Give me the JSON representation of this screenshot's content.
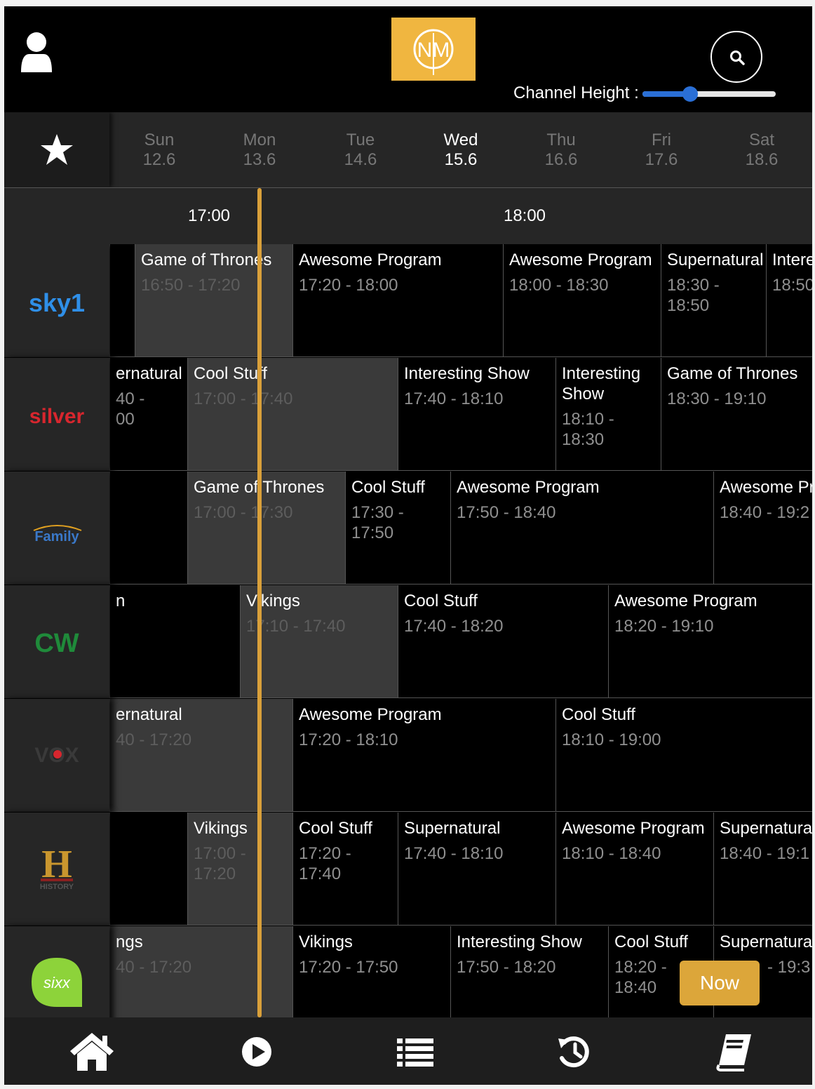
{
  "header": {
    "logo_text": "NM",
    "channel_height_label": "Channel Height :",
    "channel_height_value": 0.2
  },
  "days": [
    {
      "name": "Sun",
      "date": "12.6",
      "active": false
    },
    {
      "name": "Mon",
      "date": "13.6",
      "active": false
    },
    {
      "name": "Tue",
      "date": "14.6",
      "active": false
    },
    {
      "name": "Wed",
      "date": "15.6",
      "active": true
    },
    {
      "name": "Thu",
      "date": "16.6",
      "active": false
    },
    {
      "name": "Fri",
      "date": "17.6",
      "active": false
    },
    {
      "name": "Sat",
      "date": "18.6",
      "active": false
    }
  ],
  "timeline": {
    "labels": [
      "17:00",
      "18:00"
    ]
  },
  "channels": [
    {
      "name": "sky1",
      "logo_text": "sky1",
      "programs": [
        {
          "title": "",
          "time": "",
          "past": false
        },
        {
          "title": "Game of Thrones",
          "time": "16:50 - 17:20",
          "past": true
        },
        {
          "title": "Awesome Program",
          "time": "17:20 - 18:00",
          "past": false
        },
        {
          "title": "Awesome Program",
          "time": "18:00 - 18:30",
          "past": false
        },
        {
          "title": "Supernatural",
          "time": "18:30 - 18:50",
          "past": false
        },
        {
          "title": "Intere",
          "time": "18:50",
          "past": false
        }
      ]
    },
    {
      "name": "silver",
      "logo_text": "silver",
      "programs": [
        {
          "title": "ernatural",
          "time": "40 - 00",
          "past": false
        },
        {
          "title": "Cool Stuff",
          "time": "17:00 - 17:40",
          "past": true
        },
        {
          "title": "Interesting Show",
          "time": "17:40 - 18:10",
          "past": false
        },
        {
          "title": "Interesting Show",
          "time": "18:10 - 18:30",
          "past": false
        },
        {
          "title": "Game of Thrones",
          "time": "18:30 - 19:10",
          "past": false
        }
      ]
    },
    {
      "name": "family",
      "logo_text": "Family",
      "programs": [
        {
          "title": "",
          "time": "",
          "past": false
        },
        {
          "title": "Game of Thrones",
          "time": "17:00 - 17:30",
          "past": true
        },
        {
          "title": "Cool Stuff",
          "time": "17:30 - 17:50",
          "past": false
        },
        {
          "title": "Awesome Program",
          "time": "17:50 - 18:40",
          "past": false
        },
        {
          "title": "Awesome Pr",
          "time": "18:40 - 19:2",
          "past": false
        }
      ]
    },
    {
      "name": "cw",
      "logo_text": "CW",
      "programs": [
        {
          "title": "n",
          "time": "",
          "past": false
        },
        {
          "title": "Vikings",
          "time": "17:10 - 17:40",
          "past": true
        },
        {
          "title": "Cool Stuff",
          "time": "17:40 - 18:20",
          "past": false
        },
        {
          "title": "Awesome Program",
          "time": "18:20 - 19:10",
          "past": false
        }
      ]
    },
    {
      "name": "vox",
      "logo_text": "VOX",
      "programs": [
        {
          "title": "ernatural",
          "time": "40 - 17:20",
          "past": true
        },
        {
          "title": "Awesome Program",
          "time": "17:20 - 18:10",
          "past": false
        },
        {
          "title": "Cool Stuff",
          "time": "18:10 - 19:00",
          "past": false
        }
      ]
    },
    {
      "name": "history",
      "logo_text": "HISTORY",
      "programs": [
        {
          "title": "",
          "time": "",
          "past": false
        },
        {
          "title": "Vikings",
          "time": "17:00 - 17:20",
          "past": true
        },
        {
          "title": "Cool Stuff",
          "time": "17:20 - 17:40",
          "past": false
        },
        {
          "title": "Supernatural",
          "time": "17:40 - 18:10",
          "past": false
        },
        {
          "title": "Awesome Program",
          "time": "18:10 - 18:40",
          "past": false
        },
        {
          "title": "Supernatural",
          "time": "18:40 - 19:1",
          "past": false
        }
      ]
    },
    {
      "name": "sixx",
      "logo_text": "sixx",
      "programs": [
        {
          "title": "ngs",
          "time": "40 - 17:20",
          "past": true
        },
        {
          "title": "Vikings",
          "time": "17:20 - 17:50",
          "past": false
        },
        {
          "title": "Interesting Show",
          "time": "17:50 - 18:20",
          "past": false
        },
        {
          "title": "Cool Stuff",
          "time": "18:20 - 18:40",
          "past": false
        },
        {
          "title": "Supernatural",
          "time": "- 19:3",
          "past": false
        }
      ]
    }
  ],
  "now_button": "Now",
  "bottom_nav": [
    {
      "icon": "home-icon"
    },
    {
      "icon": "play-icon"
    },
    {
      "icon": "list-icon"
    },
    {
      "icon": "history-icon"
    },
    {
      "icon": "book-icon"
    }
  ],
  "colors": {
    "accent": "#f0b640",
    "now_line": "#d9a03a",
    "slider": "#2a6fd6",
    "past_program": "#3a3a3a"
  }
}
